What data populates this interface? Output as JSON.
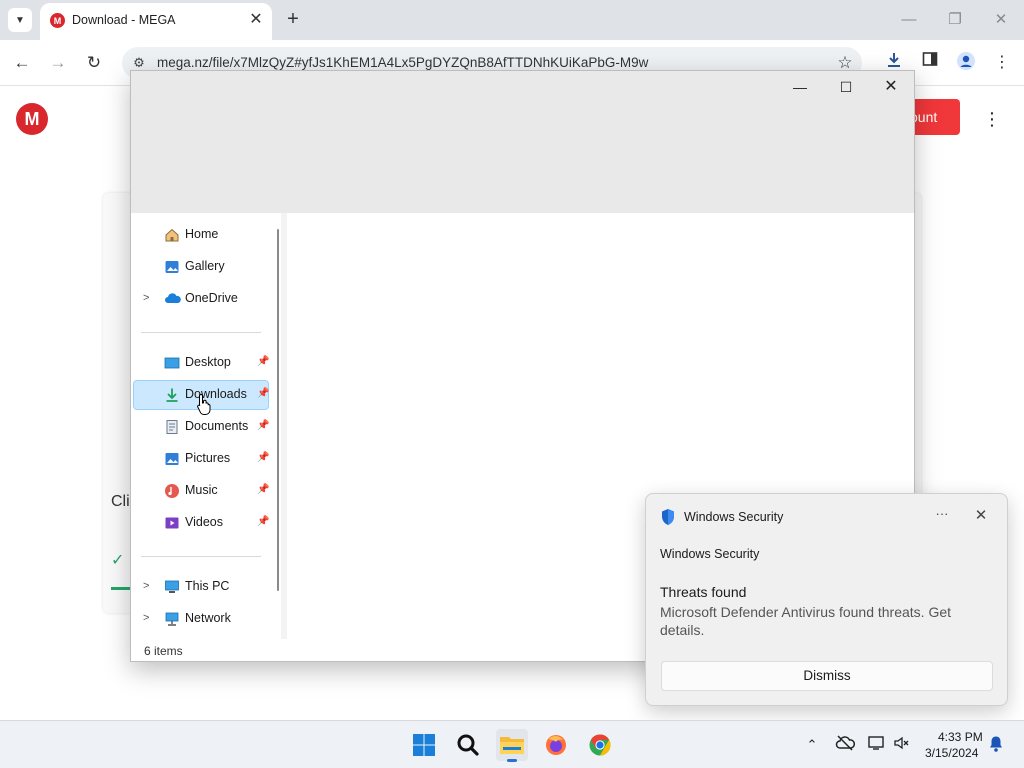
{
  "browser": {
    "tab_title": "Download - MEGA",
    "tab_favicon": "M",
    "url": "mega.nz/file/x7MlzQyZ#yfJs1KhEM1A4Lx5PgDYZQnB8AfTTDNhKUiKaPbG-M9w"
  },
  "mega": {
    "logo": "M",
    "account_button": "ount",
    "card_text": "Cli"
  },
  "explorer": {
    "nav_items": [
      {
        "label": "Home",
        "icon": "home-icon"
      },
      {
        "label": "Gallery",
        "icon": "gallery-icon"
      },
      {
        "label": "OneDrive",
        "icon": "onedrive-icon",
        "expandable": true
      },
      {
        "label": "Desktop",
        "icon": "desktop-icon",
        "pinned": true
      },
      {
        "label": "Downloads",
        "icon": "downloads-icon",
        "pinned": true,
        "selected": true
      },
      {
        "label": "Documents",
        "icon": "documents-icon",
        "pinned": true
      },
      {
        "label": "Pictures",
        "icon": "pictures-icon",
        "pinned": true
      },
      {
        "label": "Music",
        "icon": "music-icon",
        "pinned": true
      },
      {
        "label": "Videos",
        "icon": "videos-icon",
        "pinned": true
      },
      {
        "label": "This PC",
        "icon": "this-pc-icon",
        "expandable": true
      },
      {
        "label": "Network",
        "icon": "network-icon",
        "expandable": true
      }
    ],
    "status": "6 items"
  },
  "toast": {
    "app_name": "Windows Security",
    "source": "Windows Security",
    "title": "Threats found",
    "body": "Microsoft Defender Antivirus found threats. Get details.",
    "dismiss_label": "Dismiss"
  },
  "taskbar": {
    "time": "4:33 PM",
    "date": "3/15/2024"
  },
  "colors": {
    "mega_red": "#d9272e",
    "selection_blue": "#cce8ff",
    "defender_blue": "#1a66c9"
  }
}
